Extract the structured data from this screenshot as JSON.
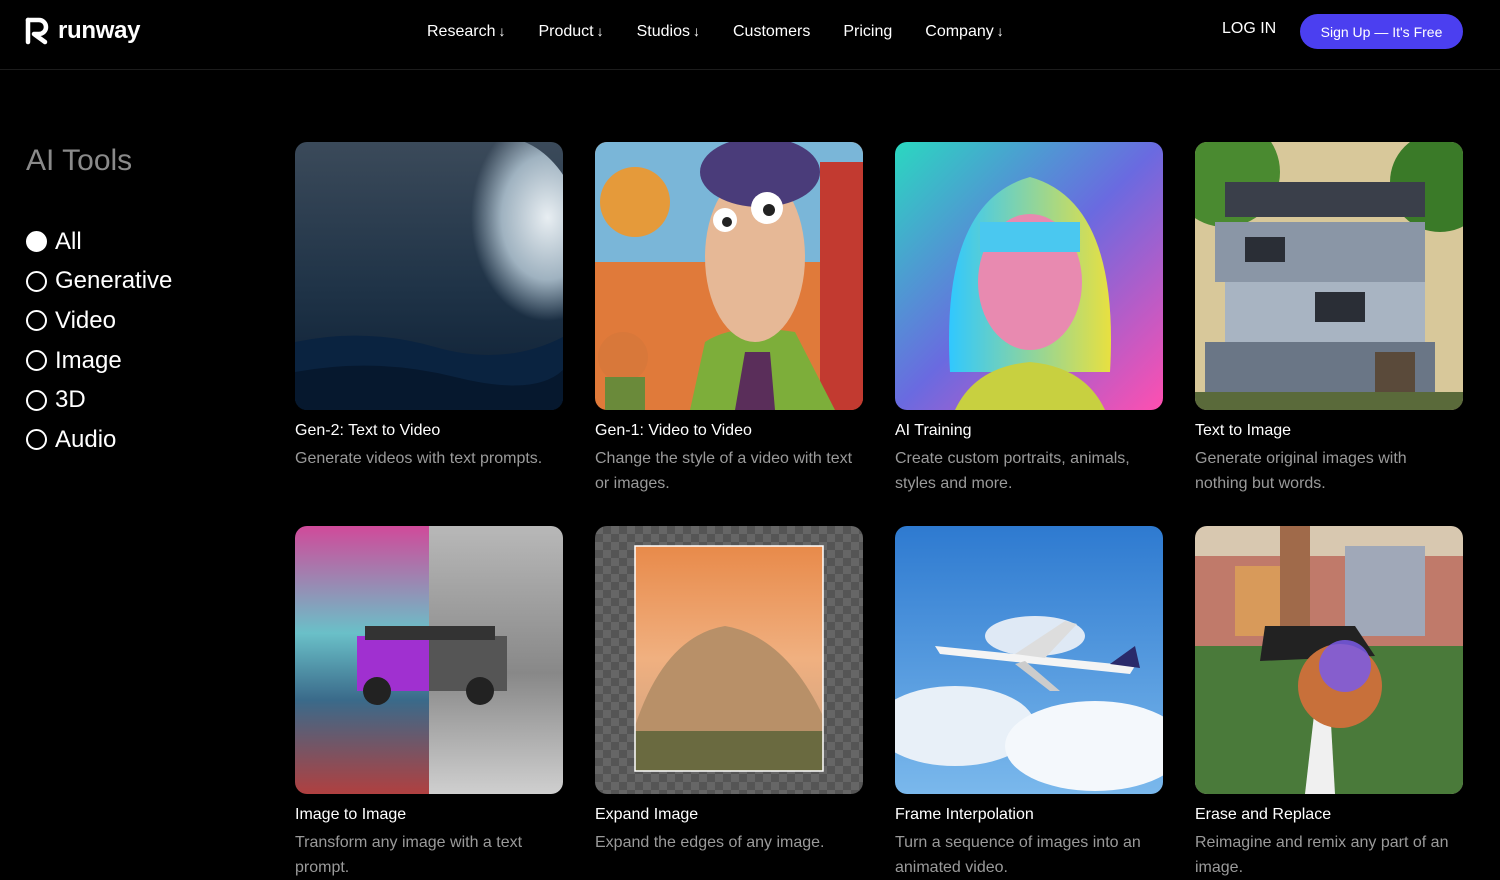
{
  "nav": {
    "logo_text": "runway",
    "menu": [
      {
        "label": "Research",
        "arrow": "↓"
      },
      {
        "label": "Product",
        "arrow": "↓"
      },
      {
        "label": "Studios",
        "arrow": "↓"
      },
      {
        "label": "Customers",
        "arrow": ""
      },
      {
        "label": "Pricing",
        "arrow": ""
      },
      {
        "label": "Company",
        "arrow": "↓"
      }
    ],
    "login_label": "LOG IN",
    "signup_label": "Sign Up — It's Free"
  },
  "sidebar": {
    "title": "AI Tools",
    "filters": [
      {
        "label": "All",
        "selected": true
      },
      {
        "label": "Generative",
        "selected": false
      },
      {
        "label": "Video",
        "selected": false
      },
      {
        "label": "Image",
        "selected": false
      },
      {
        "label": "3D",
        "selected": false
      },
      {
        "label": "Audio",
        "selected": false
      }
    ]
  },
  "tools": [
    {
      "title": "Gen-2: Text to Video",
      "desc": "Generate videos with text prompts."
    },
    {
      "title": "Gen-1: Video to Video",
      "desc": "Change the style of a video with text or images."
    },
    {
      "title": "AI Training",
      "desc": "Create custom portraits, animals, styles and more."
    },
    {
      "title": "Text to Image",
      "desc": "Generate original images with nothing but words."
    },
    {
      "title": "Image to Image",
      "desc": "Transform any image with a text prompt."
    },
    {
      "title": "Expand Image",
      "desc": "Expand the edges of any image."
    },
    {
      "title": "Frame Interpolation",
      "desc": "Turn a sequence of images into an animated video."
    },
    {
      "title": "Erase and Replace",
      "desc": "Reimagine and remix any part of an image."
    }
  ],
  "colors": {
    "accent": "#4b3ff0",
    "background": "#000000",
    "muted_text": "#9a9a9a"
  }
}
